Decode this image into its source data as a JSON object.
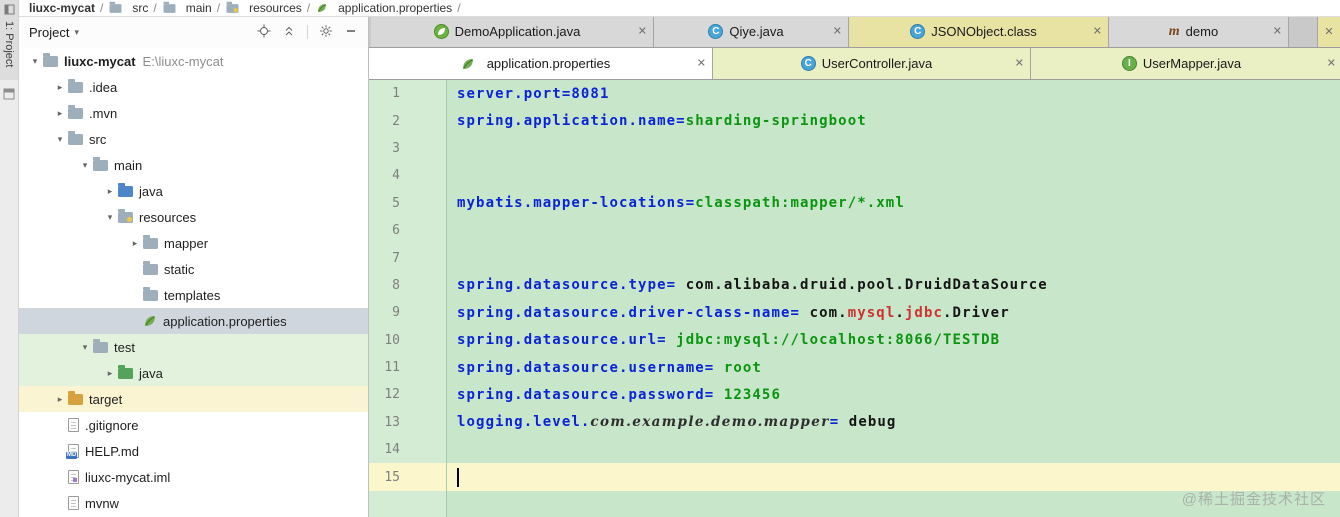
{
  "breadcrumb": {
    "separator": "/",
    "items": [
      {
        "label": "liuxc-mycat",
        "icon": null,
        "bold": true
      },
      {
        "label": "src",
        "icon": "folder",
        "bold": false
      },
      {
        "label": "main",
        "icon": "folder",
        "bold": false
      },
      {
        "label": "resources",
        "icon": "folder-res",
        "bold": false
      },
      {
        "label": "application.properties",
        "icon": "leaf",
        "bold": false
      }
    ]
  },
  "stripe": {
    "tab_label": "1: Project"
  },
  "project_panel": {
    "title": "Project",
    "tree": [
      {
        "label": "liuxc-mycat",
        "suffix": "E:\\liuxc-mycat",
        "indent": 0,
        "chevron": "down",
        "icon": "folder",
        "bold": true,
        "highlight": null
      },
      {
        "label": ".idea",
        "indent": 1,
        "chevron": "right",
        "icon": "folder",
        "highlight": null
      },
      {
        "label": ".mvn",
        "indent": 1,
        "chevron": "right",
        "icon": "folder",
        "highlight": null
      },
      {
        "label": "src",
        "indent": 1,
        "chevron": "down",
        "icon": "folder",
        "highlight": null
      },
      {
        "label": "main",
        "indent": 2,
        "chevron": "down",
        "icon": "folder",
        "highlight": null
      },
      {
        "label": "java",
        "indent": 3,
        "chevron": "right",
        "icon": "folder-java",
        "highlight": null
      },
      {
        "label": "resources",
        "indent": 3,
        "chevron": "down",
        "icon": "folder-res",
        "highlight": null
      },
      {
        "label": "mapper",
        "indent": 4,
        "chevron": "right",
        "icon": "folder",
        "highlight": null
      },
      {
        "label": "static",
        "indent": 4,
        "chevron": "none",
        "icon": "folder",
        "highlight": null
      },
      {
        "label": "templates",
        "indent": 4,
        "chevron": "none",
        "icon": "folder",
        "highlight": null
      },
      {
        "label": "application.properties",
        "indent": 4,
        "chevron": "none",
        "icon": "leaf",
        "highlight": "selected"
      },
      {
        "label": "test",
        "indent": 2,
        "chevron": "down",
        "icon": "folder",
        "highlight": "green"
      },
      {
        "label": "java",
        "indent": 3,
        "chevron": "right",
        "icon": "folder-test",
        "highlight": "green"
      },
      {
        "label": "target",
        "indent": 1,
        "chevron": "right",
        "icon": "folder-excl",
        "highlight": "yellow"
      },
      {
        "label": ".gitignore",
        "indent": 1,
        "chevron": "none",
        "icon": "file",
        "highlight": null
      },
      {
        "label": "HELP.md",
        "indent": 1,
        "chevron": "none",
        "icon": "file-md",
        "highlight": null
      },
      {
        "label": "liuxc-mycat.iml",
        "indent": 1,
        "chevron": "none",
        "icon": "file-iml",
        "highlight": null
      },
      {
        "label": "mvnw",
        "indent": 1,
        "chevron": "none",
        "icon": "file",
        "highlight": null
      }
    ]
  },
  "tabs": {
    "close_glyph": "✕",
    "row1": [
      {
        "label": "DemoApplication.java",
        "icon": "boot-class",
        "state": "normal"
      },
      {
        "label": "Qiye.java",
        "icon": "class",
        "state": "normal"
      },
      {
        "label": "JSONObject.class",
        "icon": "class",
        "state": "warm"
      },
      {
        "label": "demo",
        "icon": "maven",
        "state": "normal"
      }
    ],
    "row2": [
      {
        "label": "application.properties",
        "icon": "leaf",
        "state": "active"
      },
      {
        "label": "UserController.java",
        "icon": "class",
        "state": "warm2"
      },
      {
        "label": "UserMapper.java",
        "icon": "interface",
        "state": "warm2"
      }
    ]
  },
  "editor": {
    "cursor_line": 15,
    "lines": [
      {
        "n": 1,
        "segs": [
          [
            "server.port",
            "k"
          ],
          [
            "=",
            "k"
          ],
          [
            "8081",
            "k"
          ]
        ]
      },
      {
        "n": 2,
        "segs": [
          [
            "spring.application.name",
            "k"
          ],
          [
            "=",
            "k"
          ],
          [
            "sharding-springboot",
            "vg"
          ]
        ]
      },
      {
        "n": 3,
        "segs": []
      },
      {
        "n": 4,
        "segs": []
      },
      {
        "n": 5,
        "segs": [
          [
            "mybatis.mapper-locations",
            "k"
          ],
          [
            "=",
            "k"
          ],
          [
            "classpath:mapper/*.xml",
            "vg"
          ]
        ]
      },
      {
        "n": 6,
        "segs": []
      },
      {
        "n": 7,
        "segs": []
      },
      {
        "n": 8,
        "segs": [
          [
            "spring.datasource.type",
            "k"
          ],
          [
            "= ",
            "k"
          ],
          [
            "com.alibaba.druid.pool.DruidDataSource",
            "vk"
          ]
        ]
      },
      {
        "n": 9,
        "segs": [
          [
            "spring.datasource.driver-class-name",
            "k"
          ],
          [
            "= ",
            "k"
          ],
          [
            "com.",
            "vk"
          ],
          [
            "mysql",
            "vr"
          ],
          [
            ".",
            "vk"
          ],
          [
            "jdbc",
            "vr"
          ],
          [
            ".",
            "vk"
          ],
          [
            "Driver",
            "vk"
          ]
        ]
      },
      {
        "n": 10,
        "segs": [
          [
            "spring.datasource.url",
            "k"
          ],
          [
            "= ",
            "k"
          ],
          [
            "jdbc:mysql://localhost:8066/TESTDB",
            "vg"
          ]
        ]
      },
      {
        "n": 11,
        "segs": [
          [
            "spring.datasource.username",
            "k"
          ],
          [
            "= ",
            "k"
          ],
          [
            "root",
            "vg"
          ]
        ]
      },
      {
        "n": 12,
        "segs": [
          [
            "spring.datasource.password",
            "k"
          ],
          [
            "= ",
            "k"
          ],
          [
            "123456",
            "vg"
          ]
        ]
      },
      {
        "n": 13,
        "segs": [
          [
            "logging.level.",
            "k"
          ],
          [
            "com.example.demo.mapper",
            "vi"
          ],
          [
            "= ",
            "k"
          ],
          [
            "debug",
            "vk"
          ]
        ]
      },
      {
        "n": 14,
        "segs": []
      },
      {
        "n": 15,
        "segs": []
      }
    ]
  },
  "watermark": "@稀土掘金技术社区",
  "colors": {
    "editor_background": "#c8e6c9",
    "gutter_background": "#d4ecd4",
    "current_line": "#fbf6cc",
    "key_color": "#0a23d6",
    "value_green": "#0a9410",
    "value_red": "#d03030",
    "selected_row": "#cfd6dd",
    "vcs_green_row": "#e3f2dd",
    "excluded_row": "#faf4d3",
    "warm_tab": "#e8e3a2",
    "warm_tab2": "#eaf0c3"
  }
}
